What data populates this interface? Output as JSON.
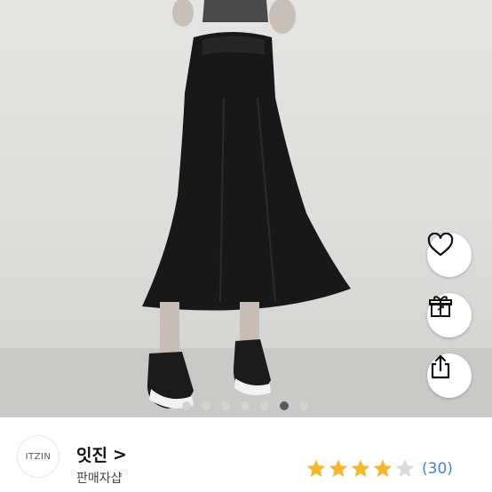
{
  "photo": {
    "alt": "",
    "carousel": {
      "count": 7,
      "active_index": 5
    }
  },
  "actions": [
    {
      "name": "heart-icon",
      "label": ""
    },
    {
      "name": "gift-icon",
      "label": ""
    },
    {
      "name": "share-icon",
      "label": ""
    }
  ],
  "seller": {
    "avatar_text": "ITZIN",
    "name": "잇진",
    "chevron": ">",
    "type": "판매자샵"
  },
  "rating": {
    "stars": 4,
    "max": 5,
    "count_text": "(30)",
    "star_color": "#f5b731",
    "empty_color": "#d9d9d9"
  }
}
